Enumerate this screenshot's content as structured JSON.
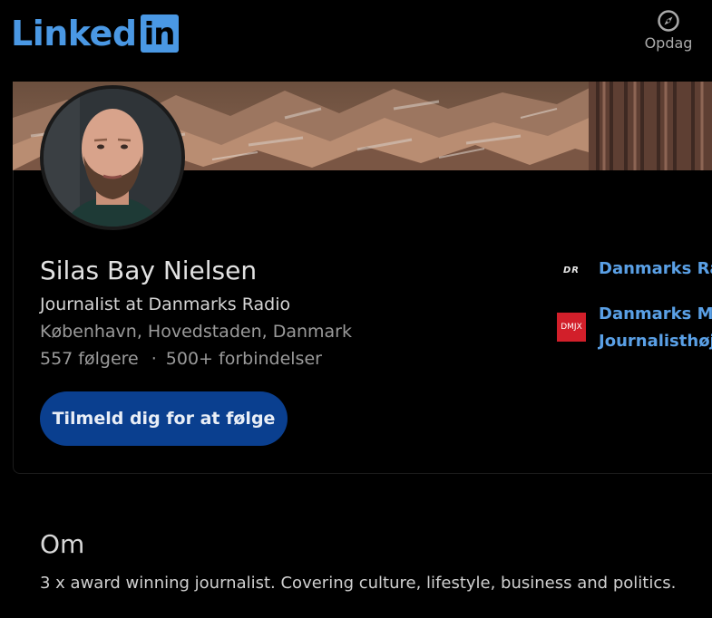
{
  "header": {
    "logo_text": "Linked",
    "logo_box": "in",
    "discover_label": "Opdag",
    "discover_icon": "compass-icon"
  },
  "profile": {
    "name": "Silas Bay Nielsen",
    "headline": "Journalist at Danmarks Radio",
    "location": "København, Hovedstaden, Danmark",
    "followers": "557 følgere",
    "separator": "·",
    "connections": "500+ forbindelser",
    "follow_button": "Tilmeld dig for at følge"
  },
  "organizations": [
    {
      "logo_text": "DR",
      "name_line1": "Danmarks Ra",
      "name_line2": ""
    },
    {
      "logo_text": "DMJX",
      "name_line1": "Danmarks Me",
      "name_line2": "Journalisthøjs"
    }
  ],
  "about": {
    "title": "Om",
    "text": "3 x award winning journalist. Covering culture, lifestyle, business and politics."
  },
  "colors": {
    "background": "#000000",
    "brand_blue": "#4a98e4",
    "link_blue": "#5aa0e6",
    "button_bg": "#0a3f8f",
    "dmjx_red": "#d21f2a"
  }
}
